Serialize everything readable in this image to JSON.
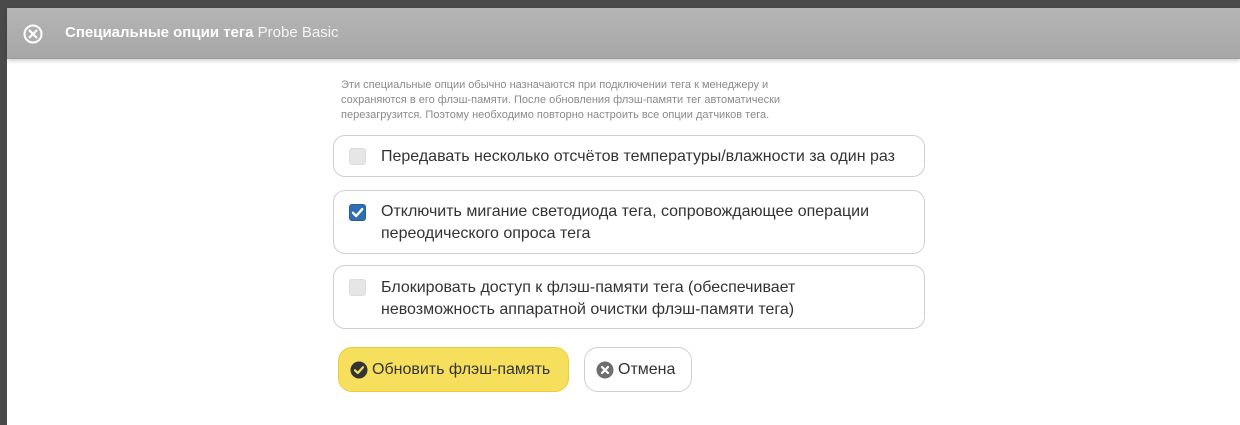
{
  "dialog": {
    "title_main": "Специальные опции тега",
    "title_sub": "Probe Basic",
    "close_icon": "close-circle-icon"
  },
  "note": {
    "lines": [
      "Эти специальные опции обычно назначаются при подключении тега к менеджеру и",
      "сохраняются в его флэш-памяти. После обновления флэш-памяти тег автоматически",
      "перезагрузится. Поэтому необходимо повторно настроить все опции датчиков тега."
    ]
  },
  "options": [
    {
      "label": "Передавать несколько отсчётов температуры/влажности за один раз",
      "checked": false
    },
    {
      "label": "Отключить мигание светодиода тега, сопровождающее операции переодического опроса тега",
      "checked": true
    },
    {
      "label": "Блокировать доступ к флэш-памяти тега (обеспечивает невозможность аппаратной очистки флэш-памяти тега)",
      "checked": false
    }
  ],
  "buttons": {
    "update_label": "Обновить флэш-память",
    "update_icon": "check-circle-icon",
    "cancel_label": "Отмена",
    "cancel_icon": "close-circle-icon"
  },
  "colors": {
    "titlebar": "#a9a9a9",
    "checkbox_checked": "#2f6fb1",
    "primary_button": "#f6df5c"
  }
}
